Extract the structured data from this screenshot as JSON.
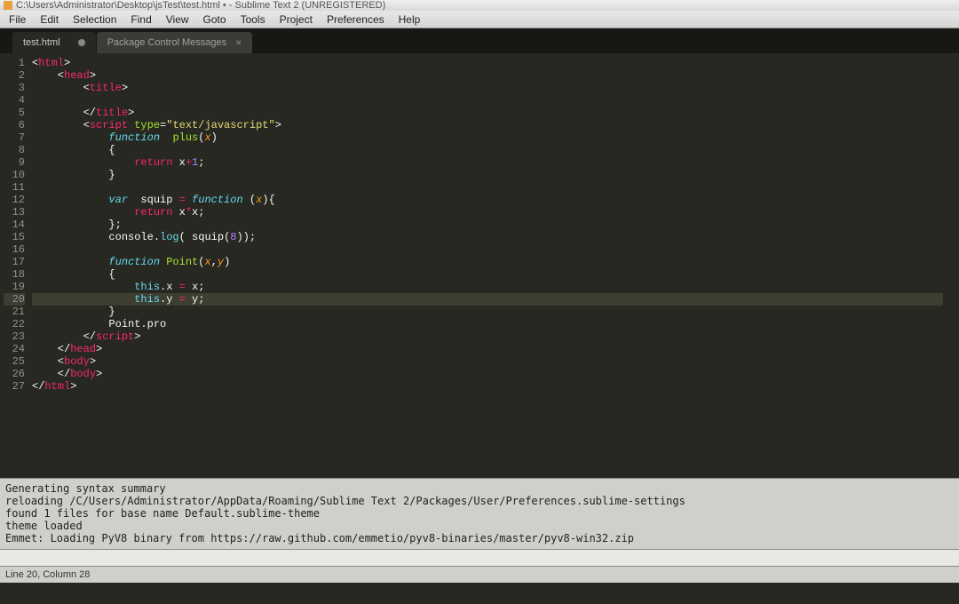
{
  "window": {
    "title": "C:\\Users\\Administrator\\Desktop\\jsTest\\test.html • - Sublime Text 2 (UNREGISTERED)"
  },
  "menu": {
    "items": [
      "File",
      "Edit",
      "Selection",
      "Find",
      "View",
      "Goto",
      "Tools",
      "Project",
      "Preferences",
      "Help"
    ]
  },
  "tabs": {
    "active": {
      "label": "test.html"
    },
    "second": {
      "label": "Package Control Messages"
    }
  },
  "editor": {
    "highlighted_line": 20,
    "line_count": 27
  },
  "code_lines": [
    [
      {
        "t": "<",
        "c": "c-punc"
      },
      {
        "t": "html",
        "c": "c-tag"
      },
      {
        "t": ">",
        "c": "c-punc"
      }
    ],
    [
      {
        "t": "    <",
        "c": "c-punc"
      },
      {
        "t": "head",
        "c": "c-tag"
      },
      {
        "t": ">",
        "c": "c-punc"
      }
    ],
    [
      {
        "t": "        <",
        "c": "c-punc"
      },
      {
        "t": "title",
        "c": "c-tag"
      },
      {
        "t": ">",
        "c": "c-punc"
      }
    ],
    [],
    [
      {
        "t": "        </",
        "c": "c-punc"
      },
      {
        "t": "title",
        "c": "c-tag"
      },
      {
        "t": ">",
        "c": "c-punc"
      }
    ],
    [
      {
        "t": "        <",
        "c": "c-punc"
      },
      {
        "t": "script",
        "c": "c-tag"
      },
      {
        "t": " ",
        "c": "c-punc"
      },
      {
        "t": "type",
        "c": "c-attr"
      },
      {
        "t": "=",
        "c": "c-punc"
      },
      {
        "t": "\"text/javascript\"",
        "c": "c-str"
      },
      {
        "t": ">",
        "c": "c-punc"
      }
    ],
    [
      {
        "t": "            ",
        "c": "c-punc"
      },
      {
        "t": "function",
        "c": "c-kw"
      },
      {
        "t": "  ",
        "c": "c-punc"
      },
      {
        "t": "plus",
        "c": "c-fn"
      },
      {
        "t": "(",
        "c": "c-punc"
      },
      {
        "t": "x",
        "c": "c-param"
      },
      {
        "t": ")",
        "c": "c-punc"
      }
    ],
    [
      {
        "t": "            {",
        "c": "c-punc"
      }
    ],
    [
      {
        "t": "                ",
        "c": "c-punc"
      },
      {
        "t": "return",
        "c": "c-op"
      },
      {
        "t": " x",
        "c": "c-txt"
      },
      {
        "t": "+",
        "c": "c-op"
      },
      {
        "t": "1",
        "c": "c-num"
      },
      {
        "t": ";",
        "c": "c-punc"
      }
    ],
    [
      {
        "t": "            }",
        "c": "c-punc"
      }
    ],
    [],
    [
      {
        "t": "            ",
        "c": "c-punc"
      },
      {
        "t": "var",
        "c": "c-kw"
      },
      {
        "t": "  squip ",
        "c": "c-txt"
      },
      {
        "t": "=",
        "c": "c-op"
      },
      {
        "t": " ",
        "c": "c-txt"
      },
      {
        "t": "function",
        "c": "c-kw"
      },
      {
        "t": " (",
        "c": "c-punc"
      },
      {
        "t": "x",
        "c": "c-param"
      },
      {
        "t": "){",
        "c": "c-punc"
      }
    ],
    [
      {
        "t": "                ",
        "c": "c-punc"
      },
      {
        "t": "return",
        "c": "c-op"
      },
      {
        "t": " x",
        "c": "c-txt"
      },
      {
        "t": "*",
        "c": "c-op"
      },
      {
        "t": "x;",
        "c": "c-txt"
      }
    ],
    [
      {
        "t": "            };",
        "c": "c-punc"
      }
    ],
    [
      {
        "t": "            console.",
        "c": "c-txt"
      },
      {
        "t": "log",
        "c": "c-kw2"
      },
      {
        "t": "( ",
        "c": "c-punc"
      },
      {
        "t": "squip",
        "c": "c-txt"
      },
      {
        "t": "(",
        "c": "c-punc"
      },
      {
        "t": "8",
        "c": "c-num"
      },
      {
        "t": "));",
        "c": "c-punc"
      }
    ],
    [],
    [
      {
        "t": "            ",
        "c": "c-punc"
      },
      {
        "t": "function",
        "c": "c-kw"
      },
      {
        "t": " ",
        "c": "c-punc"
      },
      {
        "t": "Point",
        "c": "c-fn"
      },
      {
        "t": "(",
        "c": "c-punc"
      },
      {
        "t": "x",
        "c": "c-param"
      },
      {
        "t": ",",
        "c": "c-punc"
      },
      {
        "t": "y",
        "c": "c-param"
      },
      {
        "t": ")",
        "c": "c-punc"
      }
    ],
    [
      {
        "t": "            {",
        "c": "c-punc"
      }
    ],
    [
      {
        "t": "                ",
        "c": "c-punc"
      },
      {
        "t": "this",
        "c": "c-kw2"
      },
      {
        "t": ".x ",
        "c": "c-txt"
      },
      {
        "t": "=",
        "c": "c-op"
      },
      {
        "t": " x;",
        "c": "c-txt"
      }
    ],
    [
      {
        "t": "                ",
        "c": "c-punc"
      },
      {
        "t": "this",
        "c": "c-kw2"
      },
      {
        "t": ".y ",
        "c": "c-txt"
      },
      {
        "t": "=",
        "c": "c-op"
      },
      {
        "t": " y;",
        "c": "c-txt"
      }
    ],
    [
      {
        "t": "            }",
        "c": "c-punc"
      }
    ],
    [
      {
        "t": "            Point.pro",
        "c": "c-txt"
      }
    ],
    [
      {
        "t": "        </",
        "c": "c-punc"
      },
      {
        "t": "script",
        "c": "c-tag"
      },
      {
        "t": ">",
        "c": "c-punc"
      }
    ],
    [
      {
        "t": "    </",
        "c": "c-punc"
      },
      {
        "t": "head",
        "c": "c-tag"
      },
      {
        "t": ">",
        "c": "c-punc"
      }
    ],
    [
      {
        "t": "    <",
        "c": "c-punc"
      },
      {
        "t": "body",
        "c": "c-tag"
      },
      {
        "t": ">",
        "c": "c-punc"
      }
    ],
    [
      {
        "t": "    </",
        "c": "c-punc"
      },
      {
        "t": "body",
        "c": "c-tag"
      },
      {
        "t": ">",
        "c": "c-punc"
      }
    ],
    [
      {
        "t": "</",
        "c": "c-punc"
      },
      {
        "t": "html",
        "c": "c-tag"
      },
      {
        "t": ">",
        "c": "c-punc"
      }
    ]
  ],
  "console": {
    "lines": [
      "Generating syntax summary",
      "reloading /C/Users/Administrator/AppData/Roaming/Sublime Text 2/Packages/User/Preferences.sublime-settings",
      "found 1 files for base name Default.sublime-theme",
      "theme loaded",
      "Emmet: Loading PyV8 binary from https://raw.github.com/emmetio/pyv8-binaries/master/pyv8-win32.zip"
    ]
  },
  "status": {
    "cursor": "Line 20, Column 28"
  }
}
